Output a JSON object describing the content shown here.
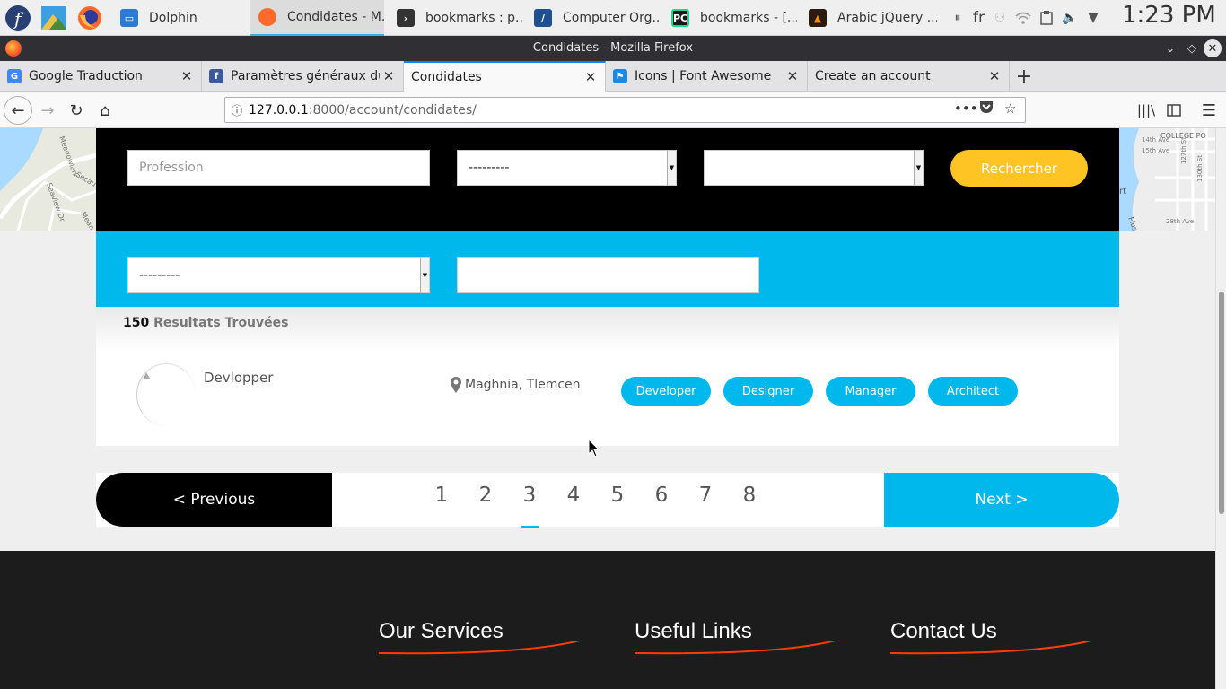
{
  "taskbar": {
    "tasks": [
      {
        "label": "Dolphin",
        "icon": "dolphin-icon",
        "color": "#2b7bd6"
      },
      {
        "label": "Condidates - M...",
        "icon": "firefox-icon",
        "color": "#ff6a2b"
      },
      {
        "label": "bookmarks : p...",
        "icon": "terminal-icon",
        "color": "#333333"
      },
      {
        "label": "Computer Org...",
        "icon": "document-viewer-icon",
        "color": "#1d4f91"
      },
      {
        "label": "bookmarks - [...",
        "icon": "pycharm-icon",
        "color": "#1a1a1a"
      },
      {
        "label": "Arabic jQuery ...",
        "icon": "vlc-icon",
        "color": "#f58b00"
      }
    ],
    "active_task": 1,
    "tray": {
      "keyboard_layout": "fr"
    },
    "clock": "1:23 PM"
  },
  "window": {
    "title": "Condidates - Mozilla Firefox"
  },
  "tabs": [
    {
      "label": "Google Traduction",
      "icon": "google-translate-icon",
      "color": "#4285f4"
    },
    {
      "label": "Paramètres généraux du",
      "icon": "facebook-icon",
      "color": "#3b5998"
    },
    {
      "label": "Condidates",
      "icon": "",
      "color": ""
    },
    {
      "label": "Icons | Font Awesome",
      "icon": "font-awesome-flag-icon",
      "color": "#1c88e6"
    },
    {
      "label": "Create an account",
      "icon": "",
      "color": ""
    }
  ],
  "active_tab": 2,
  "url": {
    "host": "127.0.0.1",
    "path": ":8000/account/condidates/"
  },
  "search": {
    "profession_placeholder": "Profession",
    "select1_value": "---------",
    "select2_value": "",
    "select3_value": "---------",
    "text_value": "",
    "button_label": "Rechercher"
  },
  "results": {
    "count": "150",
    "count_label": "Resultats Trouvées",
    "items": [
      {
        "job": "Devlopper",
        "location": "Maghnia, Tlemcen",
        "tags": [
          "Developer",
          "Designer",
          "Manager",
          "Architect"
        ]
      }
    ]
  },
  "pagination": {
    "prev_label": "< Previous",
    "next_label": "Next >",
    "pages": [
      "1",
      "2",
      "3",
      "4",
      "5",
      "6",
      "7",
      "8"
    ],
    "current": "3"
  },
  "footer": {
    "headings": [
      "Our Services",
      "Useful Links",
      "Contact Us"
    ]
  },
  "map_labels": {
    "left": [
      "Meadowlark",
      "Seaview Dr",
      "Secau",
      "Mean"
    ],
    "right": [
      "14th Ave",
      "15th Ave",
      "COLLEGE PO",
      "127th St",
      "130th St",
      "28th Ave",
      "Flus",
      "rt"
    ]
  },
  "colors": {
    "accent_blue": "#00b8ec",
    "search_button": "#fdc424",
    "footer_underline": "#ff3d00"
  }
}
